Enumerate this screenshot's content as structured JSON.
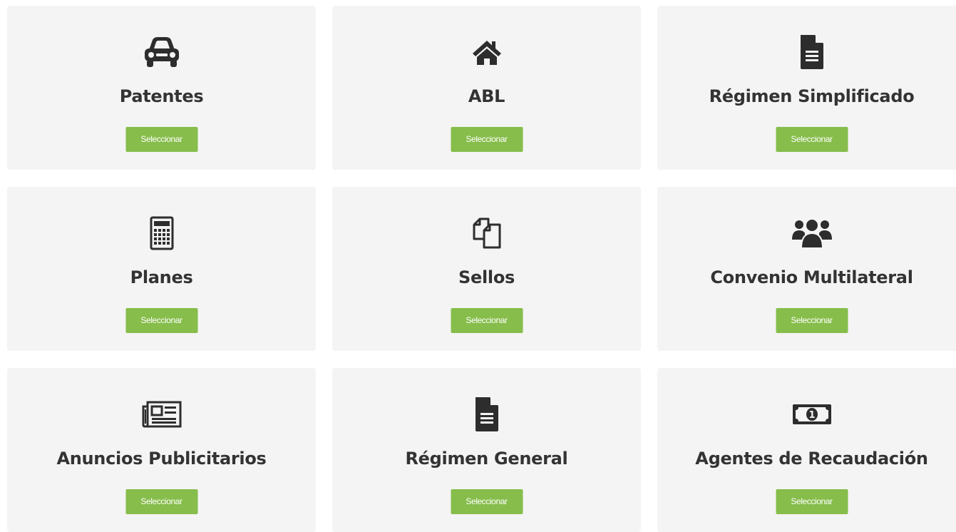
{
  "colors": {
    "card_background": "#f4f4f4",
    "button_background": "#86bd4b",
    "button_text": "#ffffff",
    "title_text": "#333333",
    "icon_color": "#2d2d2d"
  },
  "cards": [
    {
      "icon": "car-icon",
      "title": "Patentes",
      "button_label": "Seleccionar"
    },
    {
      "icon": "home-icon",
      "title": "ABL",
      "button_label": "Seleccionar"
    },
    {
      "icon": "document-icon",
      "title": "Régimen Simplificado",
      "button_label": "Seleccionar"
    },
    {
      "icon": "calculator-icon",
      "title": "Planes",
      "button_label": "Seleccionar"
    },
    {
      "icon": "copy-icon",
      "title": "Sellos",
      "button_label": "Seleccionar"
    },
    {
      "icon": "users-icon",
      "title": "Convenio Multilateral",
      "button_label": "Seleccionar"
    },
    {
      "icon": "newspaper-icon",
      "title": "Anuncios Publicitarios",
      "button_label": "Seleccionar"
    },
    {
      "icon": "document-icon",
      "title": "Régimen General",
      "button_label": "Seleccionar"
    },
    {
      "icon": "money-icon",
      "title": "Agentes de Recaudación",
      "button_label": "Seleccionar"
    }
  ]
}
